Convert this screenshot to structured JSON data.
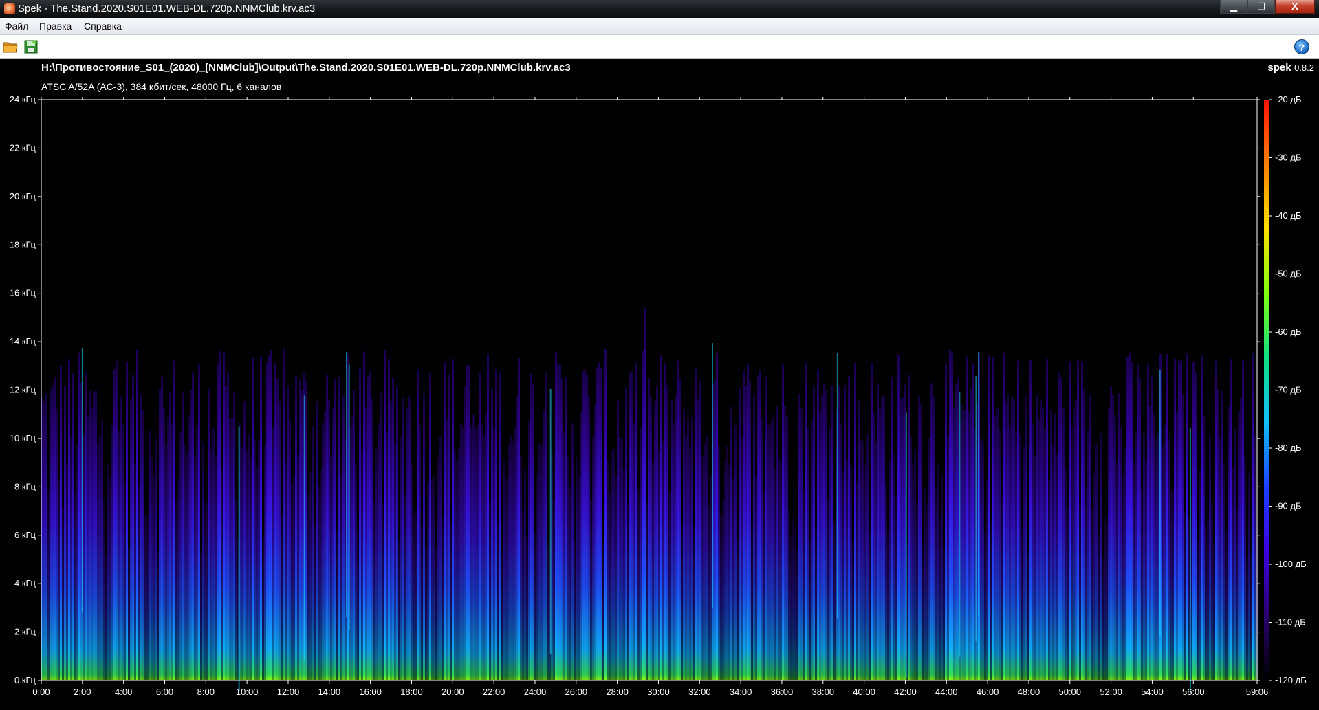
{
  "window": {
    "title": "Spek - The.Stand.2020.S01E01.WEB-DL.720p.NNMClub.krv.ac3",
    "minimize_label": "▁",
    "maximize_label": "❐",
    "close_label": "X"
  },
  "menu": {
    "items": [
      "Файл",
      "Правка",
      "Справка"
    ]
  },
  "toolbar": {
    "open_icon": "open-folder-icon",
    "save_icon": "save-image-icon",
    "help_icon": "help-icon",
    "help_label": "?"
  },
  "file": {
    "path": "H:\\Противостояние_S01_(2020)_[NNMClub]\\Output\\The.Stand.2020.S01E01.WEB-DL.720p.NNMClub.krv.ac3",
    "info": "ATSC A/52A (AC-3), 384 кбит/сек, 48000 Гц, 6 каналов"
  },
  "brand": {
    "name": "spek",
    "version": "0.8.2"
  },
  "chart_data": {
    "type": "heatmap",
    "x_ticks": [
      "0:00",
      "2:00",
      "4:00",
      "6:00",
      "8:00",
      "10:00",
      "12:00",
      "14:00",
      "16:00",
      "18:00",
      "20:00",
      "22:00",
      "24:00",
      "26:00",
      "28:00",
      "30:00",
      "32:00",
      "34:00",
      "36:00",
      "38:00",
      "40:00",
      "42:00",
      "44:00",
      "46:00",
      "48:00",
      "50:00",
      "52:00",
      "54:00",
      "56:00",
      "59:06"
    ],
    "x_tick_seconds": [
      0,
      120,
      240,
      360,
      480,
      600,
      720,
      840,
      960,
      1080,
      1200,
      1320,
      1440,
      1560,
      1680,
      1800,
      1920,
      2040,
      2160,
      2280,
      2400,
      2520,
      2640,
      2760,
      2880,
      3000,
      3120,
      3240,
      3360,
      3546
    ],
    "duration_seconds": 3546,
    "y_ticks": [
      "0 кГц",
      "2 кГц",
      "4 кГц",
      "6 кГц",
      "8 кГц",
      "10 кГц",
      "12 кГц",
      "14 кГц",
      "16 кГц",
      "18 кГц",
      "20 кГц",
      "22 кГц",
      "24 кГц"
    ],
    "y_tick_khz": [
      0,
      2,
      4,
      6,
      8,
      10,
      12,
      14,
      16,
      18,
      20,
      22,
      24
    ],
    "y_range_khz": [
      0,
      24
    ],
    "colorbar_ticks": [
      "-20 дБ",
      "-30 дБ",
      "-40 дБ",
      "-50 дБ",
      "-60 дБ",
      "-70 дБ",
      "-80 дБ",
      "-90 дБ",
      "-100 дБ",
      "-110 дБ",
      "-120 дБ"
    ],
    "colorbar_db": [
      -20,
      -30,
      -40,
      -50,
      -60,
      -70,
      -80,
      -90,
      -100,
      -110,
      -120
    ],
    "db_range": [
      -120,
      -20
    ],
    "cutoff_khz": 13.7,
    "colors": {
      "background": "#000000",
      "axis": "#ffffff",
      "scale": [
        "#000000",
        "#2a0070",
        "#3c00e0",
        "#1a40ff",
        "#10c0ff",
        "#10e080",
        "#80ff10",
        "#ffe000",
        "#ff8000",
        "#ff1000"
      ]
    }
  }
}
